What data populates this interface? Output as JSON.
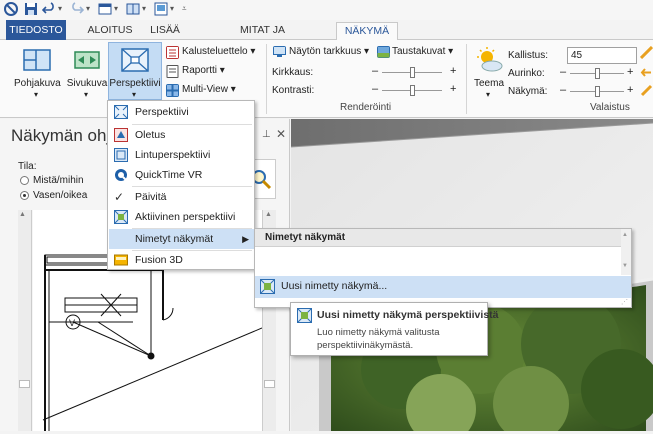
{
  "ribbon_tabs": {
    "file": "TIEDOSTO",
    "home": "ALOITUS",
    "insert": "LISÄÄ",
    "dimensions": "MITAT JA HUOMAUTUKSET",
    "view": "NÄKYMÄ"
  },
  "view_buttons": {
    "plan": "Pohjakuva",
    "elevation": "Sivukuva",
    "perspective": "Perspektiivi"
  },
  "lists": {
    "furniture_list": "Kalusteluettelo",
    "report": "Raportti",
    "multiview": "Multi-View"
  },
  "render": {
    "display_quality": "Näytön tarkkuus",
    "background": "Taustakuvat",
    "brightness": "Kirkkaus:",
    "contrast": "Kontrasti:",
    "group_title": "Renderöinti"
  },
  "lighting": {
    "theme": "Teema",
    "tilt": "Kallistus:",
    "tilt_value": "45",
    "sun": "Aurinko:",
    "view": "Näkymä:",
    "group_title": "Valaistus"
  },
  "left_panel": {
    "title": "Näkymän ohj",
    "tila_label": "Tila:",
    "radio_up_down": "Mistä/mihin",
    "radio_left_right": "Vasen/oikea"
  },
  "perspective_menu": {
    "items": {
      "perspective": "Perspektiivi",
      "default": "Oletus",
      "birds_eye": "Lintuperspektiivi",
      "quicktime": "QuickTime VR",
      "update": "Päivitä",
      "active": "Aktiivinen perspektiivi",
      "named_views": "Nimetyt näkymät",
      "fusion": "Fusion 3D"
    }
  },
  "named_views_submenu": {
    "header": "Nimetyt näkymät",
    "new_named_view": "Uusi nimetty näkymä..."
  },
  "tooltip": {
    "title": "Uusi nimetty näkymä perspektiivistä",
    "body_line1": "Luo nimetty näkymä valitusta",
    "body_line2": "perspektiivinäkymästä."
  },
  "colors": {
    "file_tab": "#2b579a",
    "highlight": "#cde0f5",
    "accent_blue": "#3a7fd0"
  }
}
